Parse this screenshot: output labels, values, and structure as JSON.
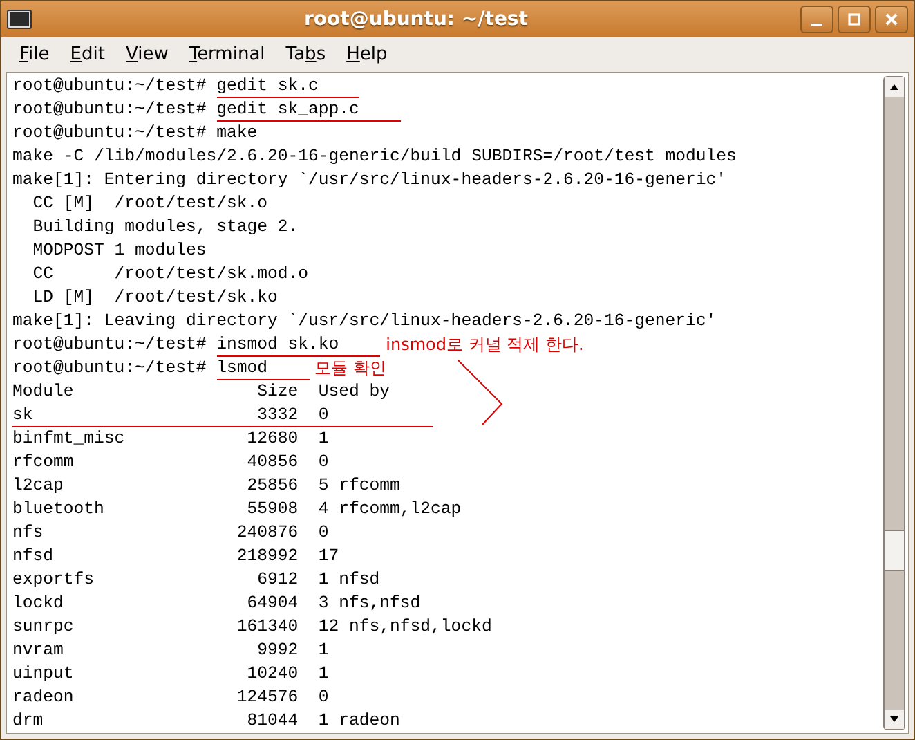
{
  "window": {
    "title": "root@ubuntu: ~/test"
  },
  "menu": [
    {
      "key": "F",
      "rest": "ile"
    },
    {
      "key": "E",
      "rest": "dit"
    },
    {
      "key": "V",
      "rest": "iew"
    },
    {
      "key": "T",
      "rest": "erminal"
    },
    {
      "lead": "Ta",
      "key": "b",
      "rest": "s"
    },
    {
      "key": "H",
      "rest": "elp"
    }
  ],
  "lines": [
    {
      "kind": "prompt",
      "prompt": "root@ubuntu:~/test#",
      "command": "gedit sk.c",
      "underlined": true
    },
    {
      "kind": "prompt",
      "prompt": "root@ubuntu:~/test#",
      "command": "gedit sk_app.c",
      "underlined": true
    },
    {
      "kind": "prompt",
      "prompt": "root@ubuntu:~/test#",
      "command": "make",
      "underlined": false
    },
    {
      "kind": "output",
      "text": "make -C /lib/modules/2.6.20-16-generic/build SUBDIRS=/root/test modules"
    },
    {
      "kind": "output",
      "text": "make[1]: Entering directory `/usr/src/linux-headers-2.6.20-16-generic'"
    },
    {
      "kind": "output",
      "text": "  CC [M]  /root/test/sk.o"
    },
    {
      "kind": "output",
      "text": "  Building modules, stage 2."
    },
    {
      "kind": "output",
      "text": "  MODPOST 1 modules"
    },
    {
      "kind": "output",
      "text": "  CC      /root/test/sk.mod.o"
    },
    {
      "kind": "output",
      "text": "  LD [M]  /root/test/sk.ko"
    },
    {
      "kind": "output",
      "text": "make[1]: Leaving directory `/usr/src/linux-headers-2.6.20-16-generic'"
    },
    {
      "kind": "prompt",
      "prompt": "root@ubuntu:~/test#",
      "command": "insmod sk.ko",
      "underlined": true,
      "note": "insmod로 커널 적제 한다."
    },
    {
      "kind": "prompt",
      "prompt": "root@ubuntu:~/test#",
      "command": "lsmod",
      "underlined": true,
      "note": "모듈 확인"
    },
    {
      "kind": "output",
      "text": "Module                  Size  Used by"
    },
    {
      "kind": "output",
      "text": "sk                      3332  0",
      "bracketed": true
    },
    {
      "kind": "output",
      "text": "binfmt_misc            12680  1"
    },
    {
      "kind": "output",
      "text": "rfcomm                 40856  0"
    },
    {
      "kind": "output",
      "text": "l2cap                  25856  5 rfcomm"
    },
    {
      "kind": "output",
      "text": "bluetooth              55908  4 rfcomm,l2cap"
    },
    {
      "kind": "output",
      "text": "nfs                   240876  0"
    },
    {
      "kind": "output",
      "text": "nfsd                  218992  17"
    },
    {
      "kind": "output",
      "text": "exportfs                6912  1 nfsd"
    },
    {
      "kind": "output",
      "text": "lockd                  64904  3 nfs,nfsd"
    },
    {
      "kind": "output",
      "text": "sunrpc                161340  12 nfs,nfsd,lockd"
    },
    {
      "kind": "output",
      "text": "nvram                   9992  1"
    },
    {
      "kind": "output",
      "text": "uinput                 10240  1"
    },
    {
      "kind": "output",
      "text": "radeon                124576  0"
    },
    {
      "kind": "output",
      "text": "drm                    81044  1 radeon"
    }
  ]
}
